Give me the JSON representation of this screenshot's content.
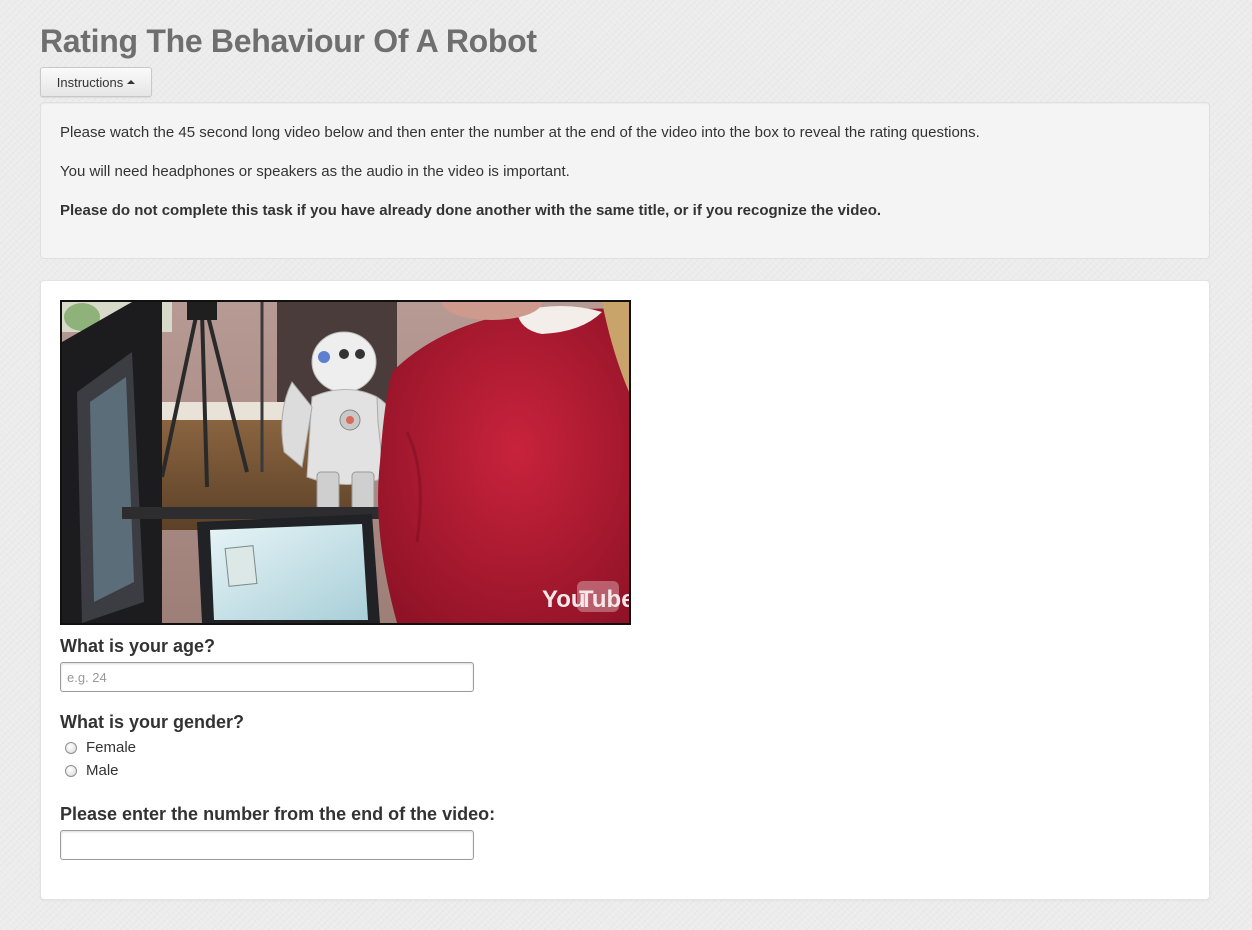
{
  "page": {
    "title": "Rating The Behaviour Of A Robot"
  },
  "instructions": {
    "toggle_label": "Instructions",
    "toggle_icon": "caret-up-icon",
    "paragraphs": [
      "Please watch the 45 second long video below and then enter the number at the end of the video into the box to reveal the rating questions.",
      "You will need headphones or speakers as the audio in the video is important.",
      "Please do not complete this task if you have already done another with the same title, or if you recognize the video."
    ]
  },
  "video": {
    "logo_text_1": "You",
    "logo_text_2": "Tube"
  },
  "form": {
    "age_label": "What is your age?",
    "age_placeholder": "e.g. 24",
    "age_value": "",
    "gender_label": "What is your gender?",
    "gender_options": [
      "Female",
      "Male"
    ],
    "number_label": "Please enter the number from the end of the video:",
    "number_value": ""
  },
  "colors": {
    "background": "#ececec",
    "title": "#6f6f6f",
    "panel": "#ffffff",
    "well": "#f4f4f4",
    "text": "#333333"
  }
}
